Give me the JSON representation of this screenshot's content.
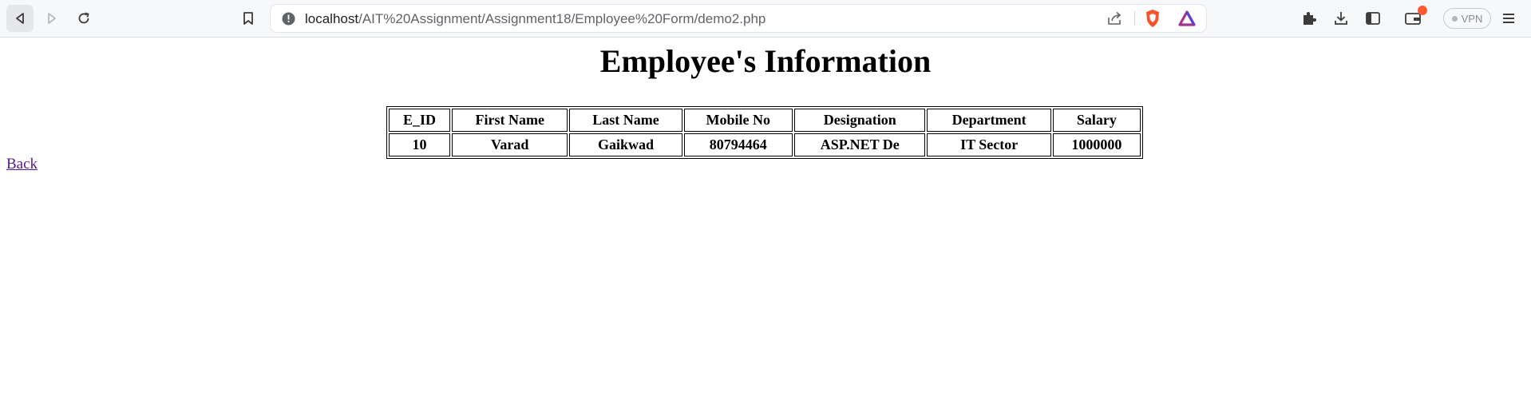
{
  "browser": {
    "url_host": "localhost",
    "url_path": "/AIT%20Assignment/Assignment18/Employee%20Form/demo2.php",
    "vpn_label": "VPN",
    "colors": {
      "toolbar_bg": "#f7f8fa",
      "wallet_badge": "#ff5a36",
      "brave_orange": "#fb542b"
    }
  },
  "page": {
    "title": "Employee's Information",
    "back_link": "Back",
    "link_color": "#551a8b"
  },
  "table": {
    "headers": [
      "E_ID",
      "First Name",
      "Last Name",
      "Mobile No",
      "Designation",
      "Department",
      "Salary"
    ],
    "rows": [
      [
        "10",
        "Varad",
        "Gaikwad",
        "80794464",
        "ASP.NET De",
        "IT Sector",
        "1000000"
      ]
    ]
  }
}
